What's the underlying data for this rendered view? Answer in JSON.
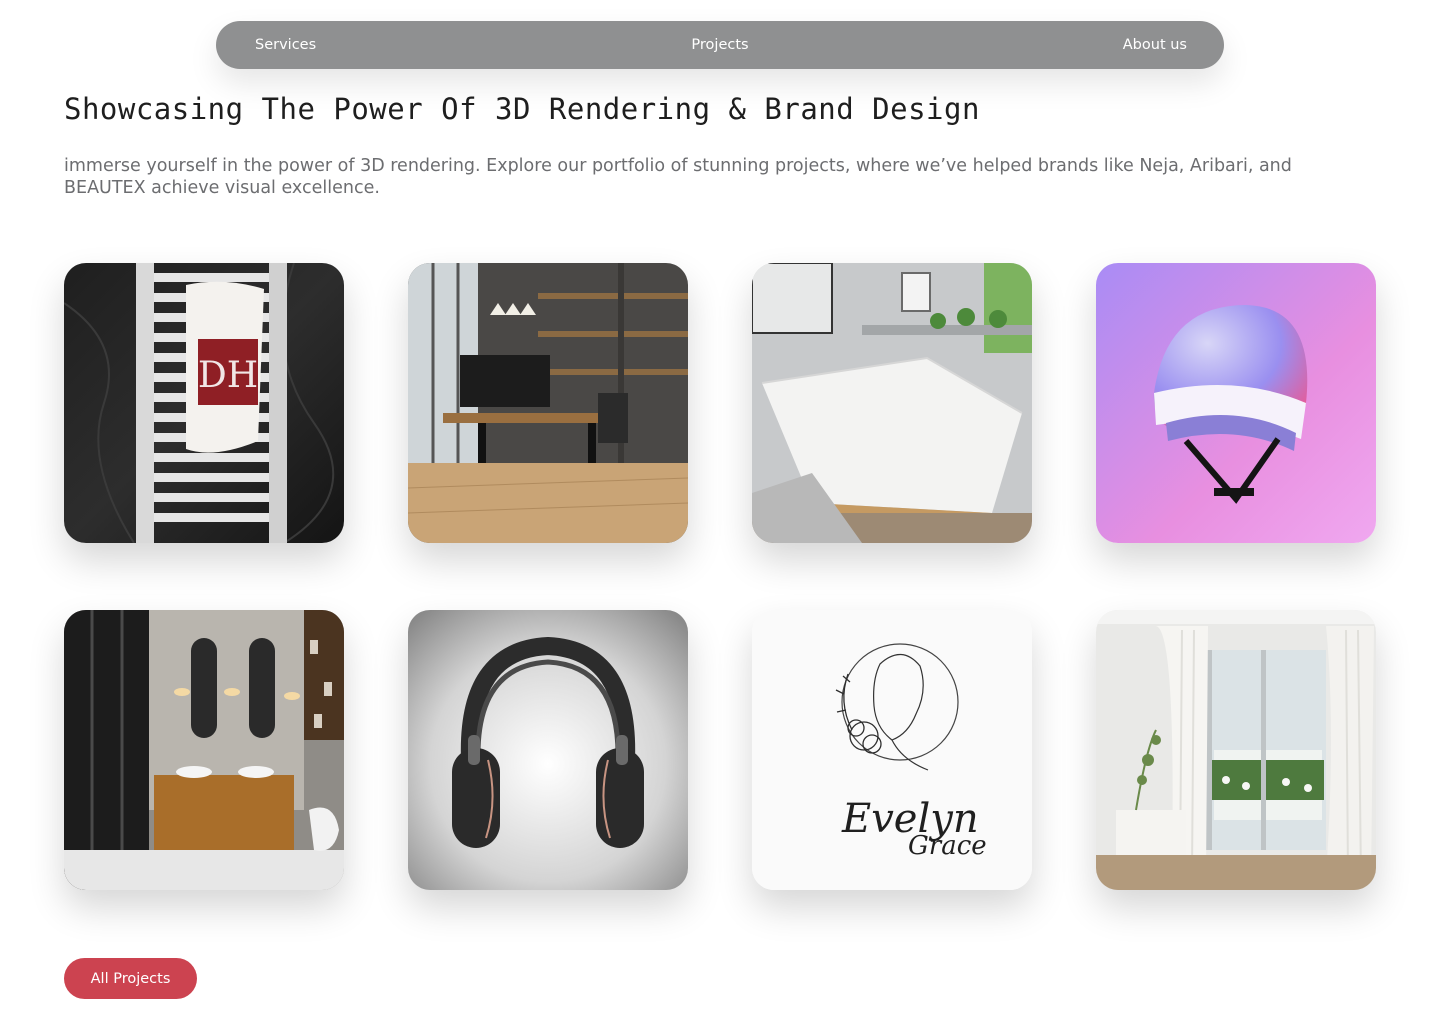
{
  "nav": {
    "services": "Services",
    "projects": "Projects",
    "about": "About us"
  },
  "hero": {
    "title": "Showcasing The Power Of 3D Rendering & Brand Design",
    "description": "immerse yourself in the power of 3D rendering. Explore our portfolio of stunning projects, where we’ve helped brands like Neja, Aribari, and BEAUTEX achieve visual excellence."
  },
  "projects": [
    {
      "subject": "towel-on-radiator",
      "logo_text": "DH"
    },
    {
      "subject": "home-office"
    },
    {
      "subject": "bedroom"
    },
    {
      "subject": "helmet"
    },
    {
      "subject": "bathroom"
    },
    {
      "subject": "headphones"
    },
    {
      "subject": "evelyn-grace-logo",
      "logo_text_1": "Evelyn",
      "logo_text_2": "Grace"
    },
    {
      "subject": "curtains-room"
    }
  ],
  "cta": {
    "label": "All Projects"
  },
  "colors": {
    "nav_bg": "#8f9091",
    "title": "#1e1e1e",
    "description": "#6c6d70",
    "cta_bg": "#cc4350"
  }
}
